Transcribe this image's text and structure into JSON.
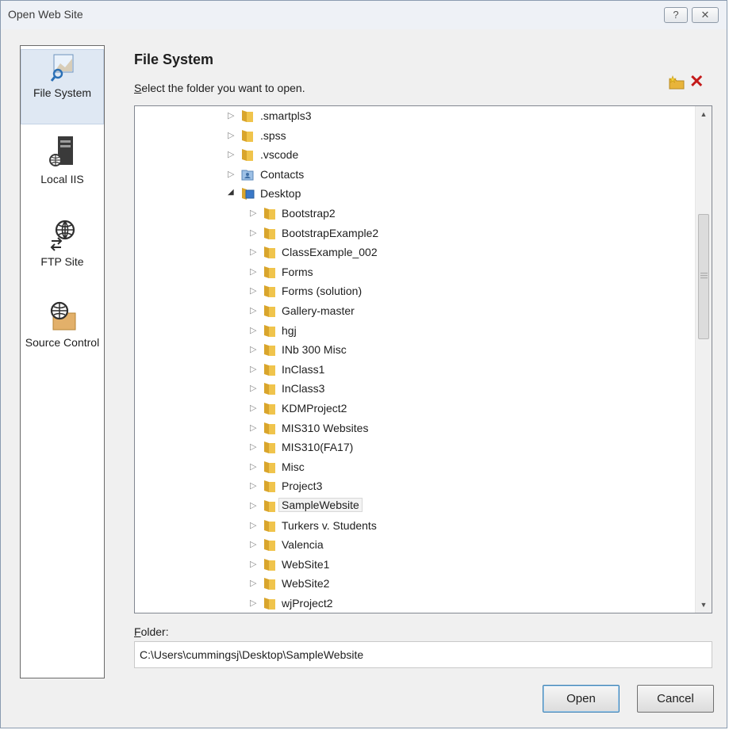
{
  "window": {
    "title": "Open Web Site",
    "help_glyph": "?",
    "close_glyph": "✕"
  },
  "nav": {
    "items": [
      {
        "label": "File System",
        "icon": "file-system-icon"
      },
      {
        "label": "Local IIS",
        "icon": "server-icon"
      },
      {
        "label": "FTP Site",
        "icon": "ftp-globe-icon"
      },
      {
        "label": "Source Control",
        "icon": "source-control-icon"
      }
    ]
  },
  "main": {
    "heading": "File System",
    "subtitle_first": "S",
    "subtitle_rest": "elect the folder you want to open."
  },
  "tree": {
    "items": [
      {
        "label": ".smartpls3",
        "level": 0,
        "expanded": false,
        "icon": "folder-icon"
      },
      {
        "label": ".spss",
        "level": 0,
        "expanded": false,
        "icon": "folder-icon"
      },
      {
        "label": ".vscode",
        "level": 0,
        "expanded": false,
        "icon": "folder-icon"
      },
      {
        "label": "Contacts",
        "level": 0,
        "expanded": false,
        "icon": "contacts-folder-icon"
      },
      {
        "label": "Desktop",
        "level": 0,
        "expanded": true,
        "icon": "desktop-folder-icon"
      },
      {
        "label": "Bootstrap2",
        "level": 1,
        "expanded": false,
        "icon": "folder-icon"
      },
      {
        "label": "BootstrapExample2",
        "level": 1,
        "expanded": false,
        "icon": "folder-icon"
      },
      {
        "label": "ClassExample_002",
        "level": 1,
        "expanded": false,
        "icon": "folder-icon"
      },
      {
        "label": "Forms",
        "level": 1,
        "expanded": false,
        "icon": "folder-icon"
      },
      {
        "label": "Forms (solution)",
        "level": 1,
        "expanded": false,
        "icon": "folder-icon"
      },
      {
        "label": "Gallery-master",
        "level": 1,
        "expanded": false,
        "icon": "folder-icon"
      },
      {
        "label": "hgj",
        "level": 1,
        "expanded": false,
        "icon": "folder-icon"
      },
      {
        "label": "INb 300 Misc",
        "level": 1,
        "expanded": false,
        "icon": "folder-icon"
      },
      {
        "label": "InClass1",
        "level": 1,
        "expanded": false,
        "icon": "folder-icon"
      },
      {
        "label": "InClass3",
        "level": 1,
        "expanded": false,
        "icon": "folder-icon"
      },
      {
        "label": "KDMProject2",
        "level": 1,
        "expanded": false,
        "icon": "folder-icon"
      },
      {
        "label": "MIS310 Websites",
        "level": 1,
        "expanded": false,
        "icon": "folder-icon"
      },
      {
        "label": "MIS310(FA17)",
        "level": 1,
        "expanded": false,
        "icon": "folder-icon"
      },
      {
        "label": "Misc",
        "level": 1,
        "expanded": false,
        "icon": "folder-icon"
      },
      {
        "label": "Project3",
        "level": 1,
        "expanded": false,
        "icon": "folder-icon"
      },
      {
        "label": "SampleWebsite",
        "level": 1,
        "expanded": false,
        "icon": "folder-icon",
        "selected": true
      },
      {
        "label": "Turkers v. Students",
        "level": 1,
        "expanded": false,
        "icon": "folder-icon"
      },
      {
        "label": "Valencia",
        "level": 1,
        "expanded": false,
        "icon": "folder-icon"
      },
      {
        "label": "WebSite1",
        "level": 1,
        "expanded": false,
        "icon": "folder-icon"
      },
      {
        "label": "WebSite2",
        "level": 1,
        "expanded": false,
        "icon": "folder-icon"
      },
      {
        "label": "wjProject2",
        "level": 1,
        "expanded": false,
        "icon": "folder-icon"
      }
    ]
  },
  "folder": {
    "label_first": "F",
    "label_rest": "older:",
    "value": "C:\\Users\\cummingsj\\Desktop\\SampleWebsite"
  },
  "buttons": {
    "open": "Open",
    "cancel": "Cancel"
  },
  "colors": {
    "folder": "#e8b43a",
    "delete": "#c41a1a",
    "selection": "#f3f3f3",
    "nav_selected": "#dfe8f3"
  }
}
